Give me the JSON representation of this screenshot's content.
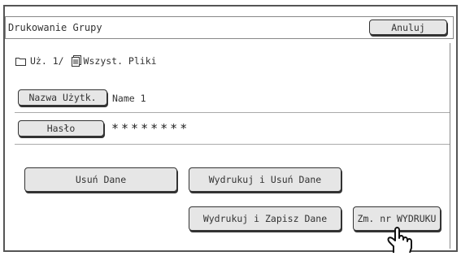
{
  "header": {
    "title": "Drukowanie Grupy",
    "cancel_label": "Anuluj"
  },
  "path": {
    "folder": "Uż. 1/",
    "files": "Wszyst. Pliki"
  },
  "fields": {
    "user_label": "Nazwa Użytk.",
    "user_value": "Name 1",
    "password_label": "Hasło",
    "password_value": "********"
  },
  "actions": {
    "delete": "Usuń Dane",
    "print_delete": "Wydrukuj i Usuń Dane",
    "print_save": "Wydrukuj i Zapisz Dane",
    "change_count": "Zm. nr WYDRUKU"
  }
}
